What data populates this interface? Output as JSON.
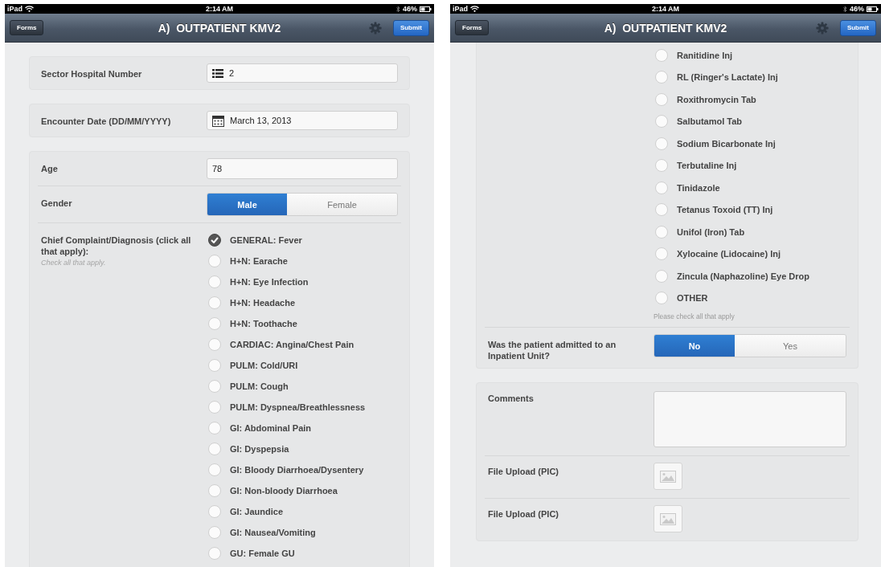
{
  "screens": [
    {
      "status_bar": {
        "carrier": "iPad",
        "time": "2:14 AM",
        "battery": "46%"
      },
      "nav": {
        "back": "Forms",
        "title": "A)  OUTPATIENT KMV2",
        "action": "Submit"
      },
      "sections": [
        {
          "fields": [
            {
              "kind": "number",
              "label": "Sector Hospital Number",
              "value": "2"
            }
          ]
        },
        {
          "fields": [
            {
              "kind": "date",
              "label": "Encounter Date (DD/MM/YYYY)",
              "value": "March 13, 2013"
            }
          ]
        },
        {
          "fields": [
            {
              "kind": "text",
              "label": "Age",
              "value": "78"
            },
            {
              "kind": "segmented",
              "label": "Gender",
              "options": [
                {
                  "label": "Male",
                  "selected": true
                },
                {
                  "label": "Female",
                  "selected": false
                }
              ]
            },
            {
              "kind": "checklist",
              "label": "Chief Complaint/Diagnosis (click all that apply):",
              "hint": "Check all that apply.",
              "options": [
                {
                  "label": "GENERAL: Fever",
                  "checked": true
                },
                {
                  "label": "H+N: Earache",
                  "checked": false
                },
                {
                  "label": "H+N:  Eye Infection",
                  "checked": false
                },
                {
                  "label": "H+N: Headache",
                  "checked": false
                },
                {
                  "label": "H+N: Toothache",
                  "checked": false
                },
                {
                  "label": "CARDIAC: Angina/Chest Pain",
                  "checked": false
                },
                {
                  "label": "PULM: Cold/URI",
                  "checked": false
                },
                {
                  "label": "PULM: Cough",
                  "checked": false
                },
                {
                  "label": "PULM: Dyspnea/Breathlessness",
                  "checked": false
                },
                {
                  "label": "GI: Abdominal Pain",
                  "checked": false
                },
                {
                  "label": "GI: Dyspepsia",
                  "checked": false
                },
                {
                  "label": "GI: Bloody Diarrhoea/Dysentery",
                  "checked": false
                },
                {
                  "label": "GI: Non-bloody Diarrhoea",
                  "checked": false
                },
                {
                  "label": "GI: Jaundice",
                  "checked": false
                },
                {
                  "label": "GI: Nausea/Vomiting",
                  "checked": false
                },
                {
                  "label": "GU: Female GU",
                  "checked": false
                }
              ]
            }
          ]
        }
      ]
    },
    {
      "status_bar": {
        "carrier": "iPad",
        "time": "2:14 AM",
        "battery": "46%"
      },
      "nav": {
        "back": "Forms",
        "title": "A)  OUTPATIENT KMV2",
        "action": "Submit"
      },
      "sections": [
        {
          "fields": [
            {
              "kind": "checklist",
              "note": "Please check all that apply",
              "options": [
                {
                  "label": "Ranitidine Inj",
                  "checked": false
                },
                {
                  "label": "RL (Ringer's Lactate) Inj",
                  "checked": false
                },
                {
                  "label": "Roxithromycin Tab",
                  "checked": false
                },
                {
                  "label": "Salbutamol Tab",
                  "checked": false
                },
                {
                  "label": "Sodium Bicarbonate Inj",
                  "checked": false
                },
                {
                  "label": "Terbutaline Inj",
                  "checked": false
                },
                {
                  "label": "Tinidazole",
                  "checked": false
                },
                {
                  "label": "Tetanus Toxoid (TT) Inj",
                  "checked": false
                },
                {
                  "label": "Unifol (Iron) Tab",
                  "checked": false
                },
                {
                  "label": "Xylocaine (Lidocaine) Inj",
                  "checked": false
                },
                {
                  "label": "Zincula (Naphazoline) Eye Drop",
                  "checked": false
                },
                {
                  "label": "OTHER",
                  "checked": false
                }
              ]
            },
            {
              "kind": "segmented",
              "label": "Was the patient admitted to an Inpatient Unit?",
              "options": [
                {
                  "label": "No",
                  "selected": true
                },
                {
                  "label": "Yes",
                  "selected": false
                }
              ]
            }
          ]
        },
        {
          "fields": [
            {
              "kind": "textarea",
              "label": "Comments"
            },
            {
              "kind": "file",
              "label": "File Upload (PIC)"
            },
            {
              "kind": "file",
              "label": "File Upload (PIC)"
            }
          ]
        }
      ]
    }
  ]
}
